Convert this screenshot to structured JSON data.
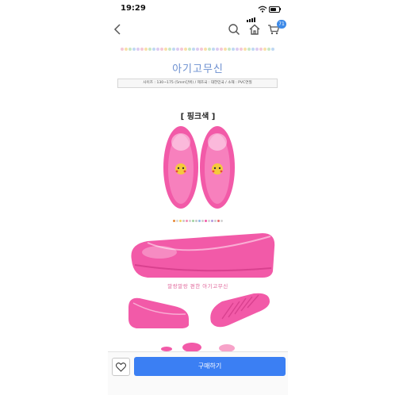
{
  "status_bar": {
    "time": "19:29"
  },
  "nav": {
    "cart_count": "71",
    "icons": [
      "back-chevron-icon",
      "search-icon",
      "home-icon",
      "cart-icon"
    ]
  },
  "product": {
    "title": "아기고무신",
    "spec_line": "사이즈 : 130~175 (5mm단위) / 제조국 : 대한민국 / 소재 : PVC연질",
    "color_label": "[ 핑크색 ]",
    "sub_caption": "말랑말랑 편한 아기고무신"
  },
  "actions": {
    "buy_label": "구매하기"
  },
  "colors": {
    "accent": "#3b7ff3",
    "title": "#6c8fd0",
    "shoe_pink": "#f25aa8",
    "caption_pink": "#e0679b"
  }
}
